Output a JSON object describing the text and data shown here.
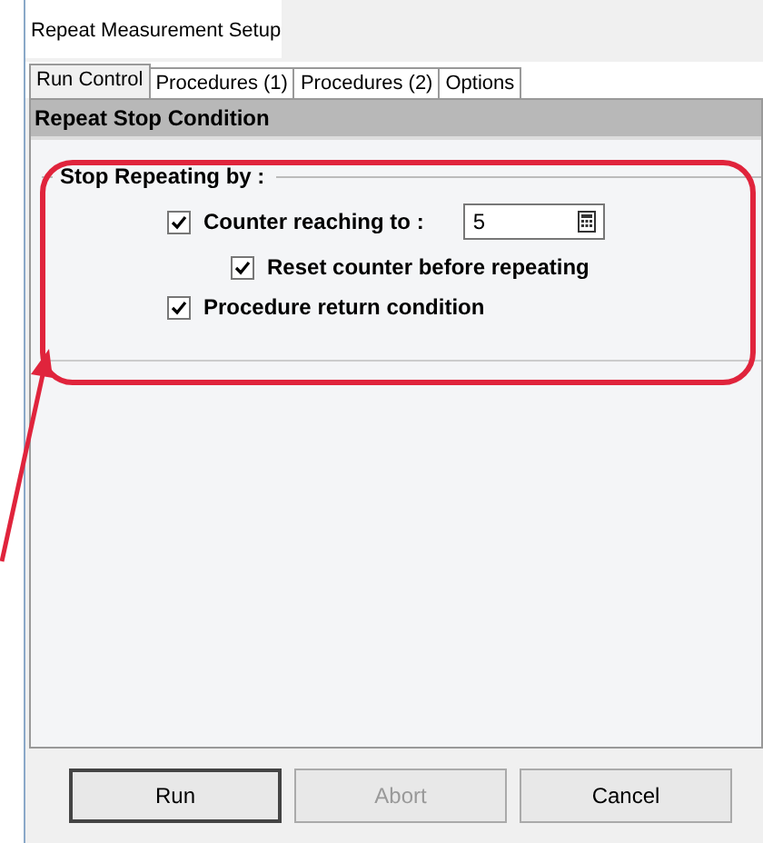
{
  "window": {
    "title": "Repeat Measurement Setup"
  },
  "tabs": [
    {
      "label": "Run Control",
      "selected": true
    },
    {
      "label": "Procedures (1)",
      "selected": false
    },
    {
      "label": "Procedures (2)",
      "selected": false
    },
    {
      "label": "Options",
      "selected": false
    }
  ],
  "section_header": "Repeat Stop Condition",
  "group": {
    "title": "Stop Repeating by :",
    "options": [
      {
        "kind": "field",
        "label": "Counter reaching to :",
        "checked": true,
        "value": "5",
        "children": [
          {
            "label": "Reset counter before repeating",
            "checked": true
          }
        ]
      },
      {
        "kind": "checkbox",
        "label": "Procedure return condition",
        "checked": true
      }
    ]
  },
  "buttons": [
    {
      "label": "Run",
      "disabled": false,
      "default": true
    },
    {
      "label": "Abort",
      "disabled": true,
      "default": false
    },
    {
      "label": "Cancel",
      "disabled": false,
      "default": false
    }
  ]
}
